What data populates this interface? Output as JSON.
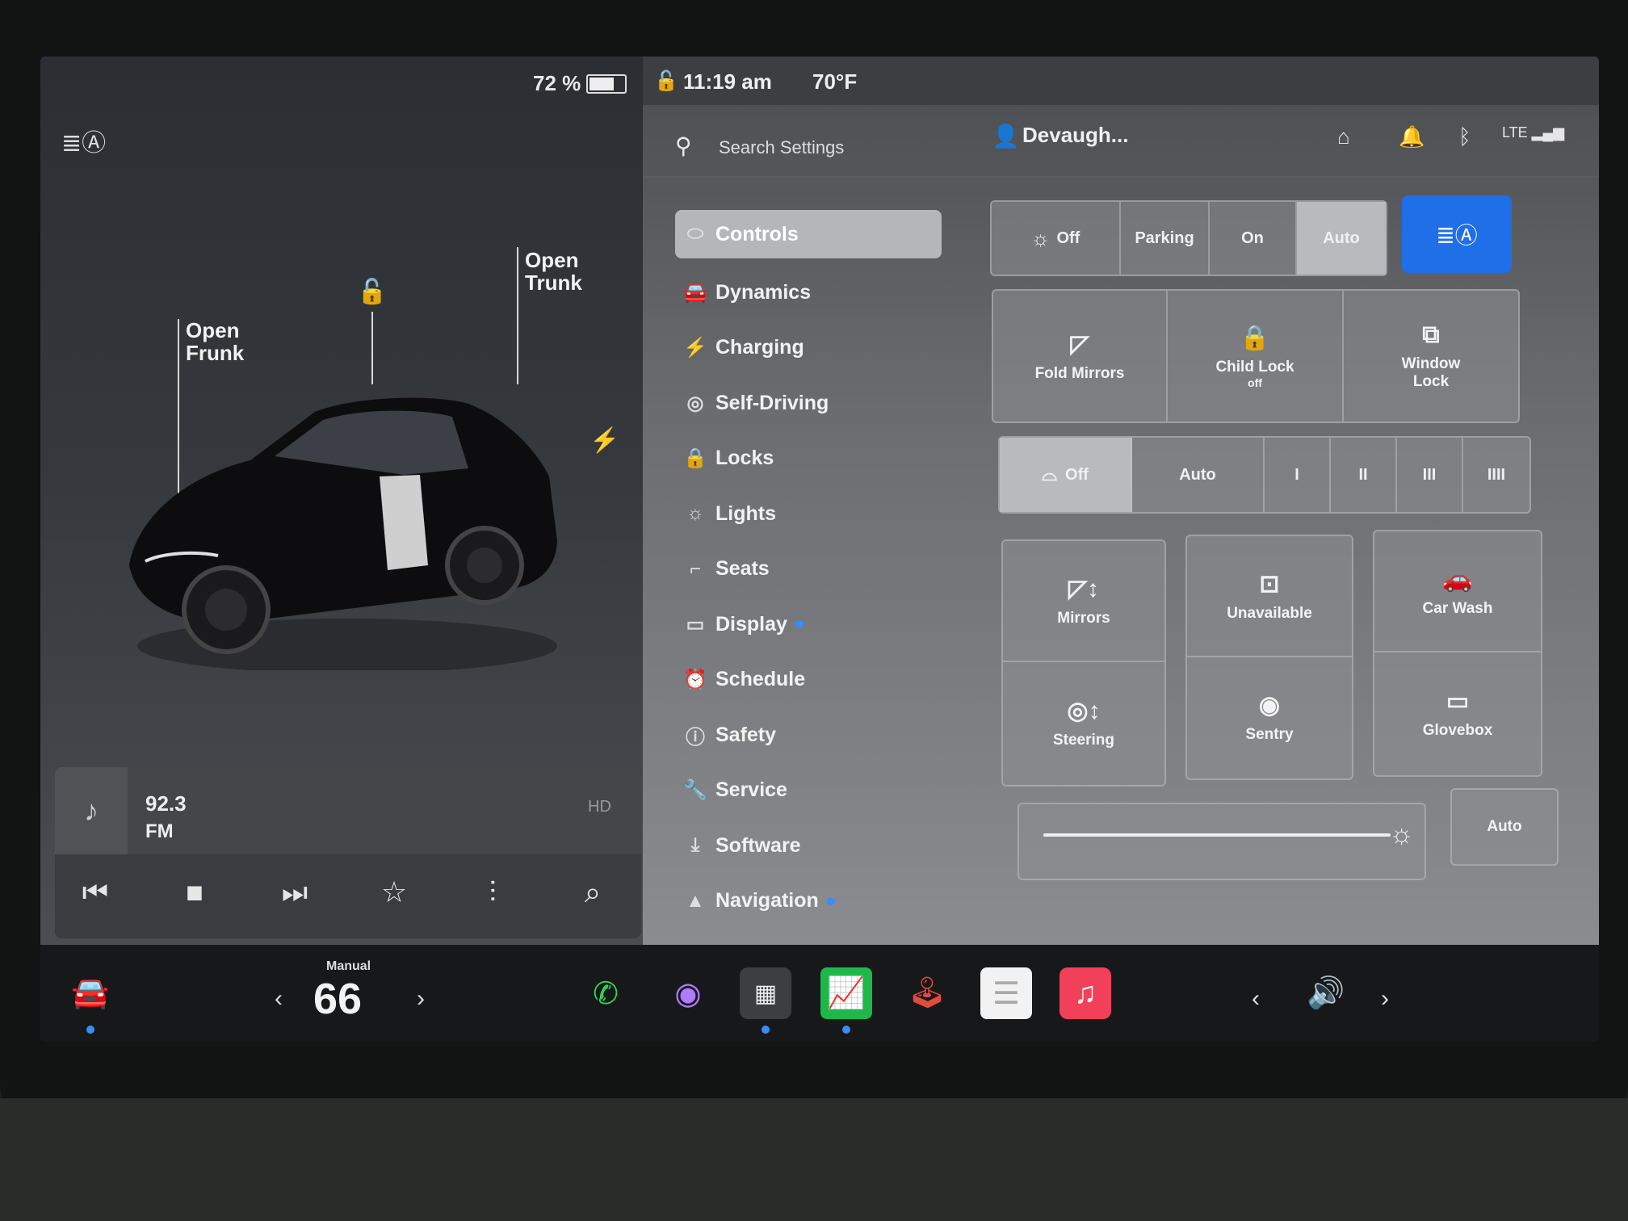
{
  "status": {
    "battery": "72 %",
    "time": "11:19 am",
    "temperature": "70°F"
  },
  "car": {
    "open_frunk": "Open\nFrunk",
    "open_trunk": "Open\nTrunk"
  },
  "media": {
    "station": "92.3",
    "band": "FM",
    "hd": "HD"
  },
  "search": {
    "placeholder": "Search Settings"
  },
  "user": {
    "name": "Devaugh..."
  },
  "menu": [
    {
      "label": "Controls",
      "icon": "toggle-icon",
      "active": true
    },
    {
      "label": "Dynamics",
      "icon": "car-icon"
    },
    {
      "label": "Charging",
      "icon": "bolt-icon"
    },
    {
      "label": "Self-Driving",
      "icon": "steering-wheel-icon"
    },
    {
      "label": "Locks",
      "icon": "lock-icon"
    },
    {
      "label": "Lights",
      "icon": "sun-icon"
    },
    {
      "label": "Seats",
      "icon": "seat-icon"
    },
    {
      "label": "Display",
      "icon": "display-icon",
      "dot": true
    },
    {
      "label": "Schedule",
      "icon": "alarm-icon"
    },
    {
      "label": "Safety",
      "icon": "alert-icon"
    },
    {
      "label": "Service",
      "icon": "wrench-icon"
    },
    {
      "label": "Software",
      "icon": "download-icon"
    },
    {
      "label": "Navigation",
      "icon": "navigation-icon",
      "dot": true
    }
  ],
  "headlights": {
    "off": "Off",
    "parking": "Parking",
    "on": "On",
    "auto": "Auto",
    "selected": "Auto"
  },
  "row1": {
    "fold_mirrors": "Fold Mirrors",
    "child_lock": "Child Lock",
    "child_lock_state": "off",
    "window_lock": "Window\nLock"
  },
  "wipers": {
    "off": "Off",
    "auto": "Auto",
    "l1": "I",
    "l2": "II",
    "l3": "III",
    "l4": "IIII",
    "selected": "Off"
  },
  "tiles": {
    "mirrors": "Mirrors",
    "unavailable": "Unavailable",
    "car_wash": "Car Wash",
    "steering": "Steering",
    "sentry": "Sentry",
    "glovebox": "Glovebox"
  },
  "brightness": {
    "auto": "Auto"
  },
  "dock": {
    "temp_mode": "Manual",
    "temp_value": "66"
  },
  "colors": {
    "accent": "#1f6fe8",
    "dot": "#3a8df7"
  }
}
